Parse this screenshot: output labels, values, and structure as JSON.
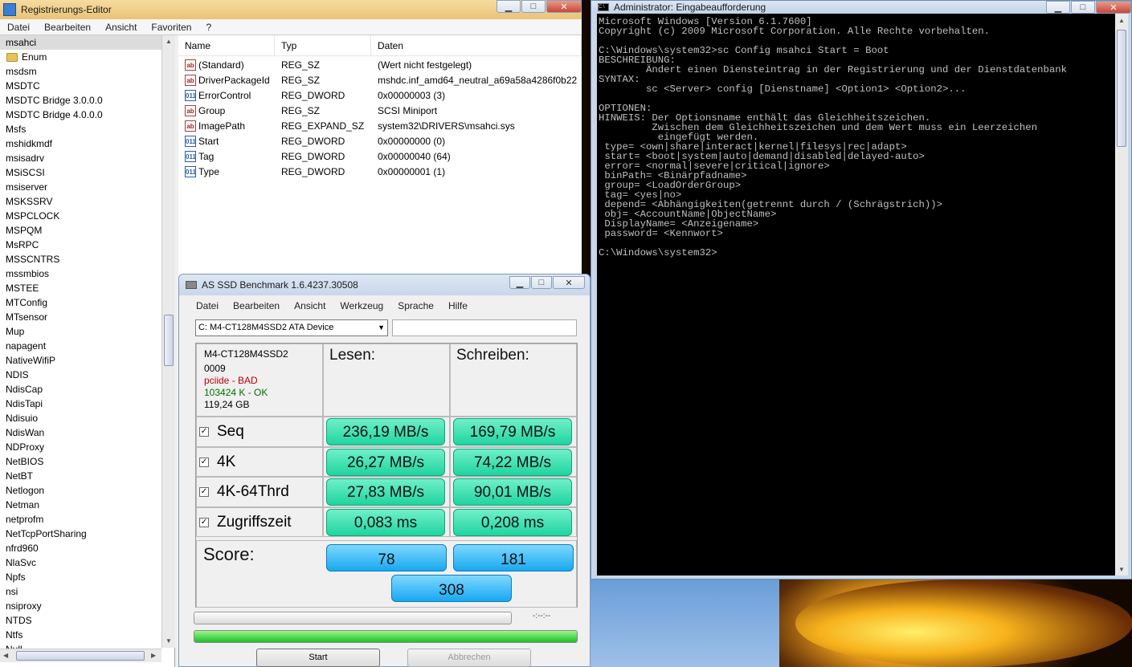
{
  "registry": {
    "title": "Registrierungs-Editor",
    "menu": [
      "Datei",
      "Bearbeiten",
      "Ansicht",
      "Favoriten",
      "?"
    ],
    "tree": {
      "selected": "msahci",
      "child": "Enum",
      "items": [
        "msdsm",
        "MSDTC",
        "MSDTC Bridge 3.0.0.0",
        "MSDTC Bridge 4.0.0.0",
        "Msfs",
        "mshidkmdf",
        "msisadrv",
        "MSiSCSI",
        "msiserver",
        "MSKSSRV",
        "MSPCLOCK",
        "MSPQM",
        "MsRPC",
        "MSSCNTRS",
        "mssmbios",
        "MSTEE",
        "MTConfig",
        "MTsensor",
        "Mup",
        "napagent",
        "NativeWifiP",
        "NDIS",
        "NdisCap",
        "NdisTapi",
        "Ndisuio",
        "NdisWan",
        "NDProxy",
        "NetBIOS",
        "NetBT",
        "Netlogon",
        "Netman",
        "netprofm",
        "NetTcpPortSharing",
        "nfrd960",
        "NlaSvc",
        "Npfs",
        "nsi",
        "nsiproxy",
        "NTDS",
        "Ntfs",
        "Null"
      ]
    },
    "columns": {
      "name": "Name",
      "type": "Typ",
      "data": "Daten"
    },
    "values": [
      {
        "icon": "ab",
        "name": "(Standard)",
        "type": "REG_SZ",
        "data": "(Wert nicht festgelegt)"
      },
      {
        "icon": "ab",
        "name": "DriverPackageId",
        "type": "REG_SZ",
        "data": "mshdc.inf_amd64_neutral_a69a58a4286f0b22"
      },
      {
        "icon": "bin",
        "name": "ErrorControl",
        "type": "REG_DWORD",
        "data": "0x00000003 (3)"
      },
      {
        "icon": "ab",
        "name": "Group",
        "type": "REG_SZ",
        "data": "SCSI Miniport"
      },
      {
        "icon": "ab",
        "name": "ImagePath",
        "type": "REG_EXPAND_SZ",
        "data": "system32\\DRIVERS\\msahci.sys"
      },
      {
        "icon": "bin",
        "name": "Start",
        "type": "REG_DWORD",
        "data": "0x00000000 (0)"
      },
      {
        "icon": "bin",
        "name": "Tag",
        "type": "REG_DWORD",
        "data": "0x00000040 (64)"
      },
      {
        "icon": "bin",
        "name": "Type",
        "type": "REG_DWORD",
        "data": "0x00000001 (1)"
      }
    ]
  },
  "ssd": {
    "title": "AS SSD Benchmark 1.6.4237.30508",
    "menu": [
      "Datei",
      "Bearbeiten",
      "Ansicht",
      "Werkzeug",
      "Sprache",
      "Hilfe"
    ],
    "drive": "C: M4-CT128M4SSD2 ATA Device",
    "info": {
      "model": "M4-CT128M4SSD2",
      "fw": "0009",
      "driver": "pciide - BAD",
      "align": "103424 K - OK",
      "size": "119,24 GB"
    },
    "colors": {
      "bad": "#c00000",
      "ok": "#007000"
    },
    "read_label": "Lesen:",
    "write_label": "Schreiben:",
    "tests": [
      {
        "label": "Seq",
        "read": "236,19 MB/s",
        "write": "169,79 MB/s"
      },
      {
        "label": "4K",
        "read": "26,27 MB/s",
        "write": "74,22 MB/s"
      },
      {
        "label": "4K-64Thrd",
        "read": "27,83 MB/s",
        "write": "90,01 MB/s"
      },
      {
        "label": "Zugriffszeit",
        "read": "0,083 ms",
        "write": "0,208 ms"
      }
    ],
    "score_label": "Score:",
    "score": {
      "read": "78",
      "write": "181",
      "total": "308"
    },
    "timer": "-:--:--",
    "progress_fraction": 1.0,
    "start": "Start",
    "cancel": "Abbrechen"
  },
  "cmd": {
    "title": "Administrator: Eingabeaufforderung",
    "lines": [
      "Microsoft Windows [Version 6.1.7600]",
      "Copyright (c) 2009 Microsoft Corporation. Alle Rechte vorbehalten.",
      "",
      "C:\\Windows\\system32>sc Config msahci Start = Boot",
      "BESCHREIBUNG:",
      "        Ändert einen Diensteintrag in der Registrierung und der Dienstdatenbank",
      "SYNTAX:",
      "        sc <Server> config [Dienstname] <Option1> <Option2>...",
      "",
      "OPTIONEN:",
      "HINWEIS: Der Optionsname enthält das Gleichheitszeichen.",
      "         Zwischen dem Gleichheitszeichen und dem Wert muss ein Leerzeichen",
      "          eingefügt werden.",
      " type= <own|share|interact|kernel|filesys|rec|adapt>",
      " start= <boot|system|auto|demand|disabled|delayed-auto>",
      " error= <normal|severe|critical|ignore>",
      " binPath= <Binärpfadname>",
      " group= <LoadOrderGroup>",
      " tag= <yes|no>",
      " depend= <Abhängigkeiten(getrennt durch / (Schrägstrich))>",
      " obj= <AccountName|ObjectName>",
      " DisplayName= <Anzeigename>",
      " password= <Kennwort>",
      "",
      "C:\\Windows\\system32>"
    ]
  }
}
